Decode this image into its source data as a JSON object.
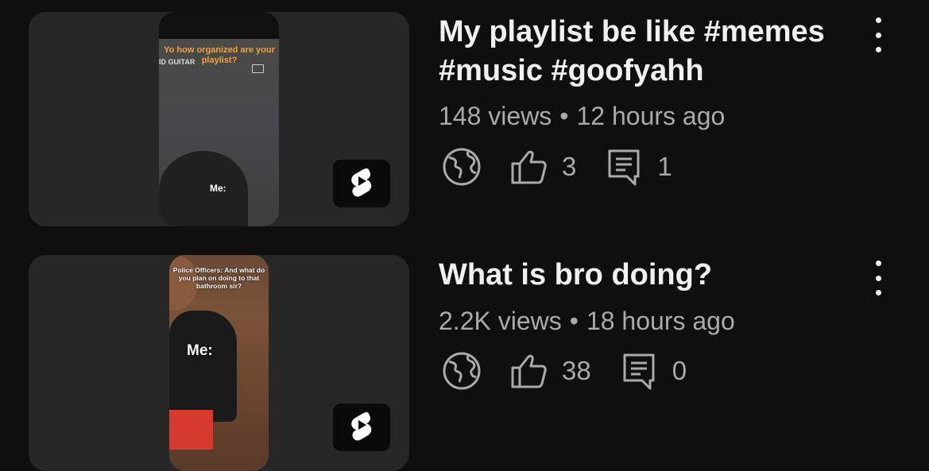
{
  "videos": [
    {
      "title": "My playlist be like #memes #music #goofyahh",
      "views": "148 views",
      "age": "12 hours ago",
      "likes": "3",
      "comments": "1",
      "thumb_caption_top": "Yo how organized are your playlist?",
      "thumb_caption_side": "ID GUITAR",
      "thumb_caption_me": "Me:"
    },
    {
      "title": "What is bro doing?",
      "views": "2.2K views",
      "age": "18 hours ago",
      "likes": "38",
      "comments": "0",
      "thumb_caption_top": "Police Officers: And what do you plan on doing to that bathroom sir?",
      "thumb_caption_me": "Me:"
    }
  ],
  "meta_separator": "•",
  "icons": {
    "visibility": "globe-icon",
    "likes": "thumbs-up-icon",
    "comments": "comment-icon",
    "more": "more-vertical-icon",
    "badge": "shorts-icon"
  },
  "colors": {
    "background": "#0f0f0f",
    "card": "#272727",
    "text_primary": "#f1f1f1",
    "text_secondary": "#aaaaaa",
    "caption_orange": "#f2a23a"
  }
}
